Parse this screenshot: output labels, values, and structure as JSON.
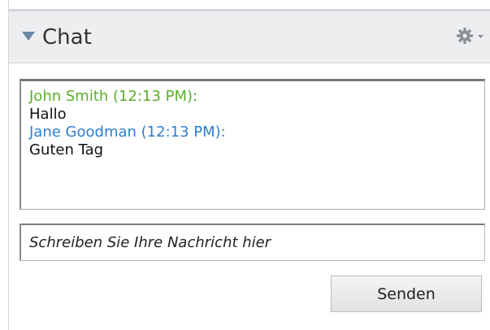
{
  "header": {
    "title": "Chat",
    "collapse_icon": "triangle-down-icon",
    "settings_icon": "gear-icon"
  },
  "messages": [
    {
      "sender": "John Smith (12:13 PM):",
      "text": "Hallo",
      "color": "#5cae2a"
    },
    {
      "sender": "Jane Goodman (12:13 PM):",
      "text": "Guten Tag",
      "color": "#2e7ed1"
    }
  ],
  "composer": {
    "placeholder": "Schreiben Sie Ihre Nachricht hier",
    "send_label": "Senden"
  },
  "colors": {
    "header_bg": "#eceef0",
    "sender_green": "#5cae2a",
    "sender_blue": "#2e7ed1",
    "collapse_icon": "#6b87a8"
  }
}
